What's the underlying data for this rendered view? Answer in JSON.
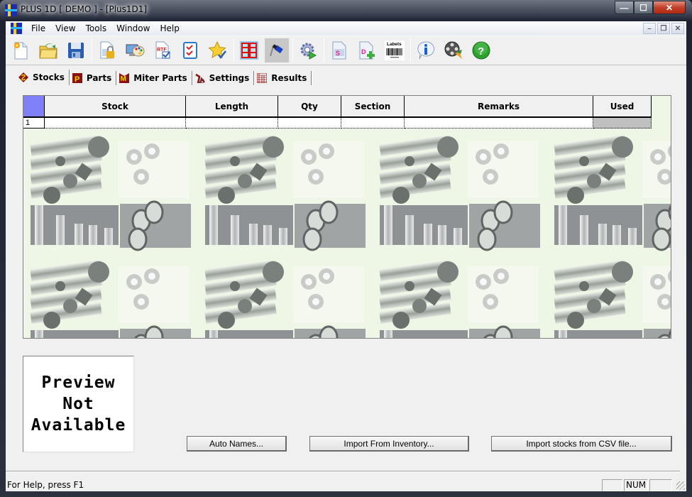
{
  "window": {
    "title": "PLUS 1D [ DEMO ] - [Plus1D1]",
    "caption_buttons": {
      "minimize": "—",
      "maximize": "☐",
      "close": "✕"
    },
    "mdi_buttons": {
      "minimize": "–",
      "restore": "❐",
      "close": "✕"
    }
  },
  "menu": {
    "items": [
      {
        "label": "File"
      },
      {
        "label": "View"
      },
      {
        "label": "Tools"
      },
      {
        "label": "Window"
      },
      {
        "label": "Help"
      }
    ]
  },
  "toolbar": {
    "groups": [
      [
        {
          "name": "new-file",
          "icon": "new-document-icon"
        },
        {
          "name": "open-file",
          "icon": "open-folder-icon"
        },
        {
          "name": "save-file",
          "icon": "floppy-disk-icon"
        }
      ],
      [
        {
          "name": "lock-document",
          "icon": "document-lock-icon"
        },
        {
          "name": "display-settings",
          "icon": "palette-monitor-icon"
        },
        {
          "name": "rtf-report",
          "icon": "rtf-document-icon"
        },
        {
          "name": "checklist",
          "icon": "checklist-icon"
        },
        {
          "name": "favorites",
          "icon": "star-check-icon"
        }
      ],
      [
        {
          "name": "layout-grid",
          "icon": "grid-layout-icon"
        },
        {
          "name": "paint-tool",
          "icon": "paint-brush-icon"
        }
      ],
      [
        {
          "name": "optimize-run",
          "icon": "gear-play-icon"
        }
      ],
      [
        {
          "name": "stock-sheet",
          "icon": "document-s-icon"
        },
        {
          "name": "add-document",
          "icon": "document-add-icon"
        },
        {
          "name": "labels",
          "icon": "barcode-labels-icon",
          "label": "Labels"
        }
      ],
      [
        {
          "name": "info",
          "icon": "info-bubble-icon"
        },
        {
          "name": "video-tutorial",
          "icon": "film-reel-icon"
        },
        {
          "name": "help",
          "icon": "help-circle-icon",
          "glyph": "?"
        }
      ]
    ]
  },
  "tabs": [
    {
      "label": "Stocks",
      "active": true,
      "icon": "stocks-icon"
    },
    {
      "label": "Parts",
      "active": false,
      "icon": "parts-icon"
    },
    {
      "label": "Miter Parts",
      "active": false,
      "icon": "miter-parts-icon"
    },
    {
      "label": "Settings",
      "active": false,
      "icon": "settings-icon"
    },
    {
      "label": "Results",
      "active": false,
      "icon": "results-icon"
    }
  ],
  "grid": {
    "columns": [
      "Stock",
      "Length",
      "Qty",
      "Section",
      "Remarks",
      "Used"
    ],
    "rows": [
      {
        "index": "1",
        "cells": [
          "",
          "",
          "",
          "",
          "",
          ""
        ]
      }
    ]
  },
  "preview": {
    "lines": [
      "Preview",
      "Not",
      "Available"
    ]
  },
  "buttons": {
    "auto_names": "Auto Names...",
    "import_inventory": "Import From Inventory...",
    "import_csv": "Import stocks from CSV file..."
  },
  "statusbar": {
    "help_text": "For Help, press F1",
    "indicators": [
      "",
      "NUM",
      ""
    ]
  },
  "colors": {
    "grid_corner": "#7f7ff7",
    "used_cell": "#c0c0c0",
    "close_button": "#c2412a"
  }
}
